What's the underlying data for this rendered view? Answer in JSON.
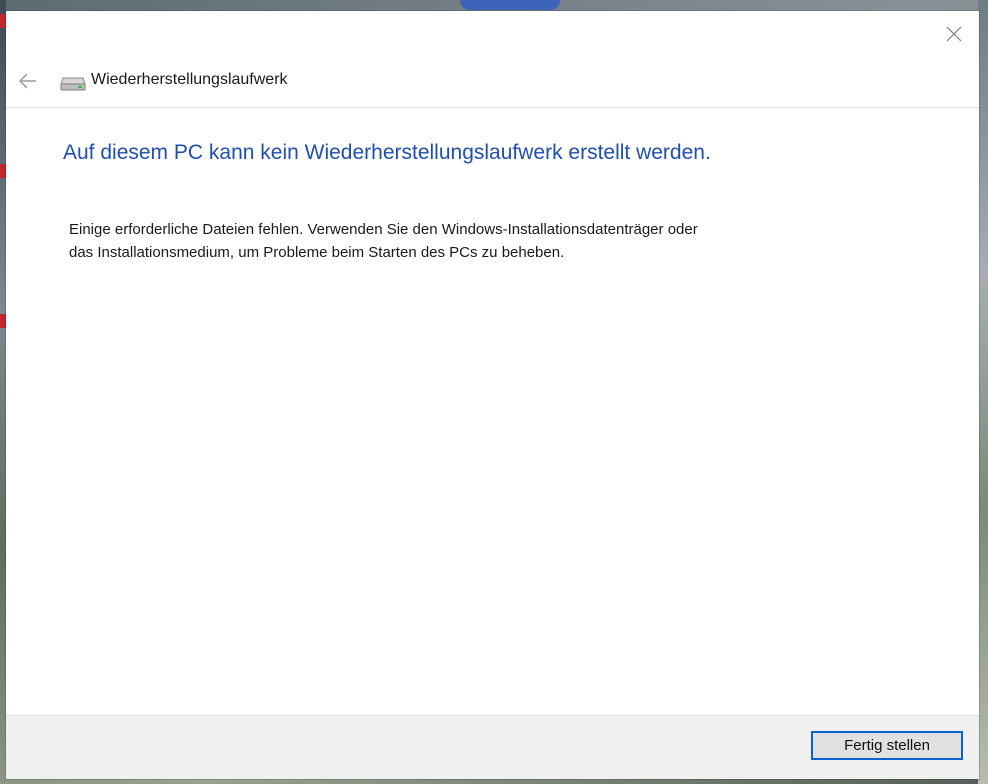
{
  "window": {
    "title": "Wiederherstellungslaufwerk",
    "close_icon": "close-icon",
    "back_icon": "back-arrow-icon",
    "drive_icon": "drive-icon"
  },
  "content": {
    "heading": "Auf diesem PC kann kein Wiederherstellungslaufwerk erstellt werden.",
    "message_line1": "Einige erforderliche Dateien fehlen. Verwenden Sie den Windows-Installationsdatenträger oder",
    "message_line2": "das Installationsmedium, um Probleme beim Starten des PCs zu beheben."
  },
  "footer": {
    "finish_label": "Fertig stellen"
  },
  "colors": {
    "heading": "#1f4fae",
    "button_border": "#0a64d0",
    "footer_bg": "#f0f0f0"
  }
}
